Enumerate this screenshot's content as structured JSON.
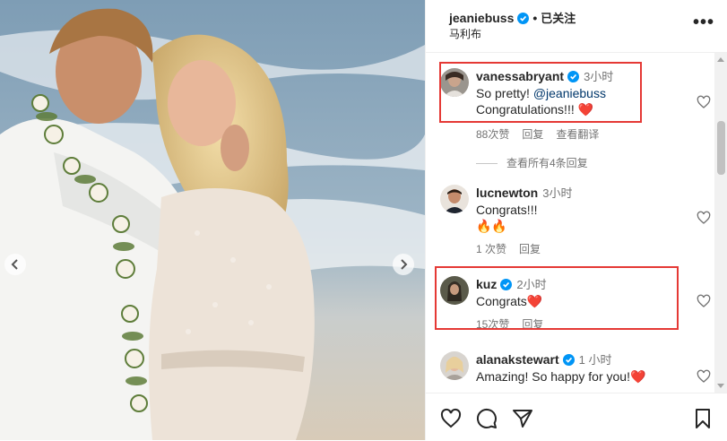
{
  "post": {
    "username": "jeaniebuss",
    "follow_status": "已关注",
    "location": "马利布",
    "dot": "•",
    "more_glyph": "•••"
  },
  "comments": [
    {
      "username": "vanessabryant",
      "verified": true,
      "time": "3小时",
      "text_line1": "So pretty! ",
      "mention": "@jeaniebuss",
      "text_line2": "Congratulations!!! ❤️",
      "likes": "88次赞",
      "reply": "回复",
      "translate": "查看翻译"
    },
    {
      "username": "lucnewton",
      "verified": false,
      "time": "3小时",
      "text_line1": "Congrats!!!",
      "text_line2": "🔥🔥",
      "likes": "1 次赞",
      "reply": "回复"
    },
    {
      "username": "kuz",
      "verified": true,
      "time": "2小时",
      "text_line1": "Congrats❤️",
      "likes": "15次赞",
      "reply": "回复"
    },
    {
      "username": "alanakstewart",
      "verified": true,
      "time": "1 小时",
      "text_line1": "Amazing! So happy for you!❤️"
    }
  ],
  "view_replies": "查看所有4条回复",
  "icons": {
    "like": "heart-icon",
    "comment": "comment-icon",
    "share": "send-icon",
    "save": "bookmark-icon"
  },
  "colors": {
    "verified": "#0095f6",
    "highlight_box": "#e53935",
    "muted_text": "#737373"
  }
}
